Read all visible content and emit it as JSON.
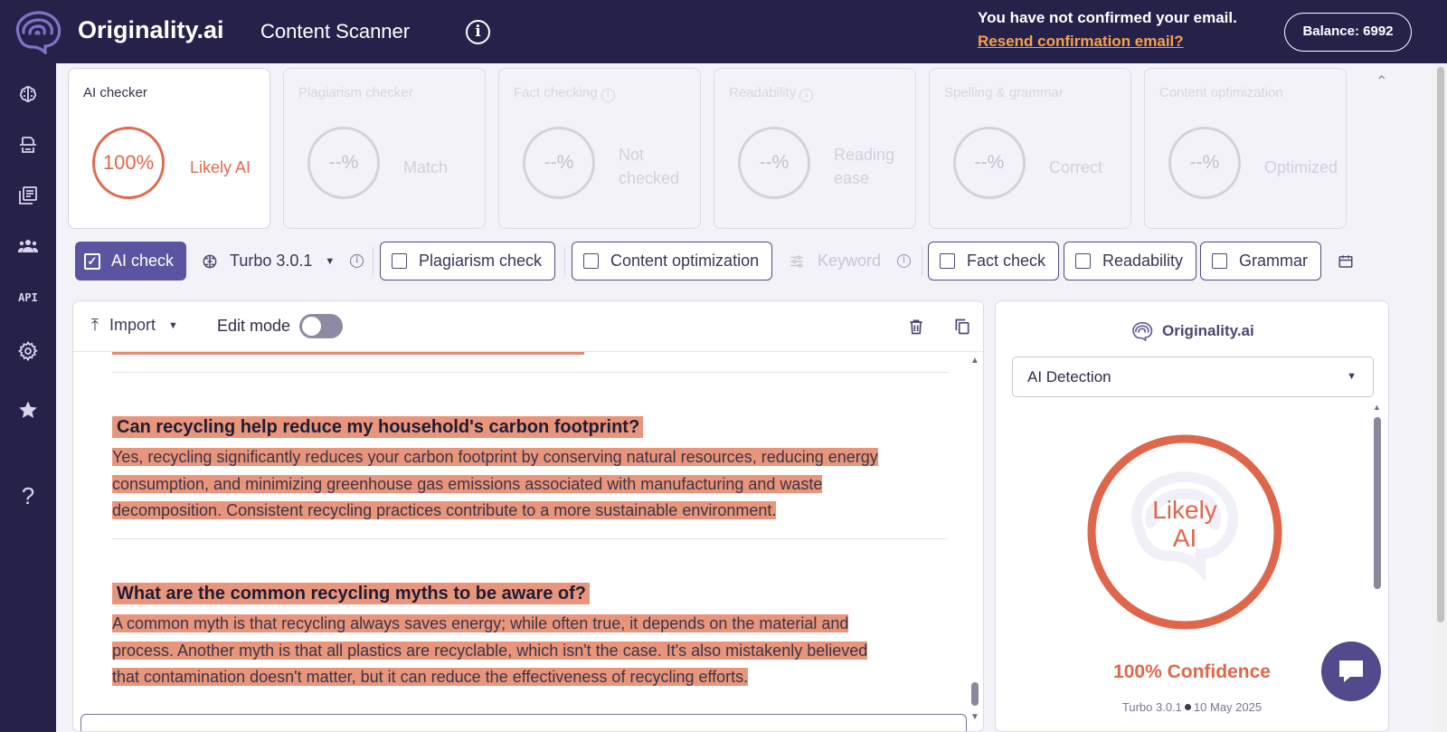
{
  "header": {
    "brand": "Originality.ai",
    "app_title": "Content Scanner",
    "info_glyph": "i",
    "email_warning": "You have not confirmed your email.",
    "resend_link": "Resend confirmation email?",
    "balance": "Balance: 6992"
  },
  "sidebar": {
    "items": [
      {
        "name": "brain-icon"
      },
      {
        "name": "scan-document-icon"
      },
      {
        "name": "library-icon"
      },
      {
        "name": "team-icon"
      },
      {
        "name": "api-icon",
        "label": "API"
      },
      {
        "name": "gear-icon"
      },
      {
        "name": "star-icon"
      },
      {
        "name": "help-icon",
        "label": "?"
      }
    ]
  },
  "cards": [
    {
      "title": "AI checker",
      "value": "100%",
      "label": "Likely AI",
      "active": true
    },
    {
      "title": "Plagiarism checker",
      "value": "--%",
      "label": "Match"
    },
    {
      "title": "Fact checking",
      "value": "--%",
      "label_line1": "Not",
      "label_line2": "checked"
    },
    {
      "title": "Readability",
      "value": "--%",
      "label_line1": "Reading",
      "label_line2": "ease"
    },
    {
      "title": "Spelling & grammar",
      "value": "--%",
      "label": "Correct"
    },
    {
      "title": "Content optimization",
      "value": "--%",
      "label": "Optimized"
    }
  ],
  "toolbar": {
    "ai_check": "AI check",
    "model": "Turbo 3.0.1",
    "plagiarism": "Plagiarism check",
    "content_opt": "Content optimization",
    "keyword": "Keyword",
    "fact_check": "Fact check",
    "readability": "Readability",
    "grammar": "Grammar"
  },
  "editor": {
    "import_label": "Import",
    "edit_mode_label": "Edit mode",
    "edit_mode_on": false,
    "blocks": [
      {
        "question": "Can recycling help reduce my household's carbon footprint?",
        "answer_lines": [
          "Yes, recycling significantly reduces your carbon footprint by conserving natural resources, reducing energy",
          "consumption, and minimizing greenhouse gas emissions associated with manufacturing and waste",
          "decomposition.  Consistent recycling practices contribute to a more sustainable environment."
        ]
      },
      {
        "question": "What are the common recycling myths to be aware of?",
        "answer_lines": [
          "A common myth is that recycling always saves energy; while often true, it depends on the material and",
          "process.  Another myth is that all plastics are recyclable, which isn't the case.  It's also mistakenly believed",
          "that contamination doesn't matter, but it can reduce the effectiveness of recycling efforts."
        ]
      }
    ]
  },
  "results": {
    "brand": "Originality.ai",
    "detection_select": "AI Detection",
    "ring_line1": "Likely",
    "ring_line2": "AI",
    "confidence": "100% Confidence",
    "model": "Turbo 3.0.1",
    "date": "10 May 2025"
  },
  "colors": {
    "brand_dark": "#262149",
    "accent_purple": "#5b54a0",
    "ai_red": "#e0664b",
    "highlight": "#e9957c",
    "link_orange": "#f5a14f"
  }
}
